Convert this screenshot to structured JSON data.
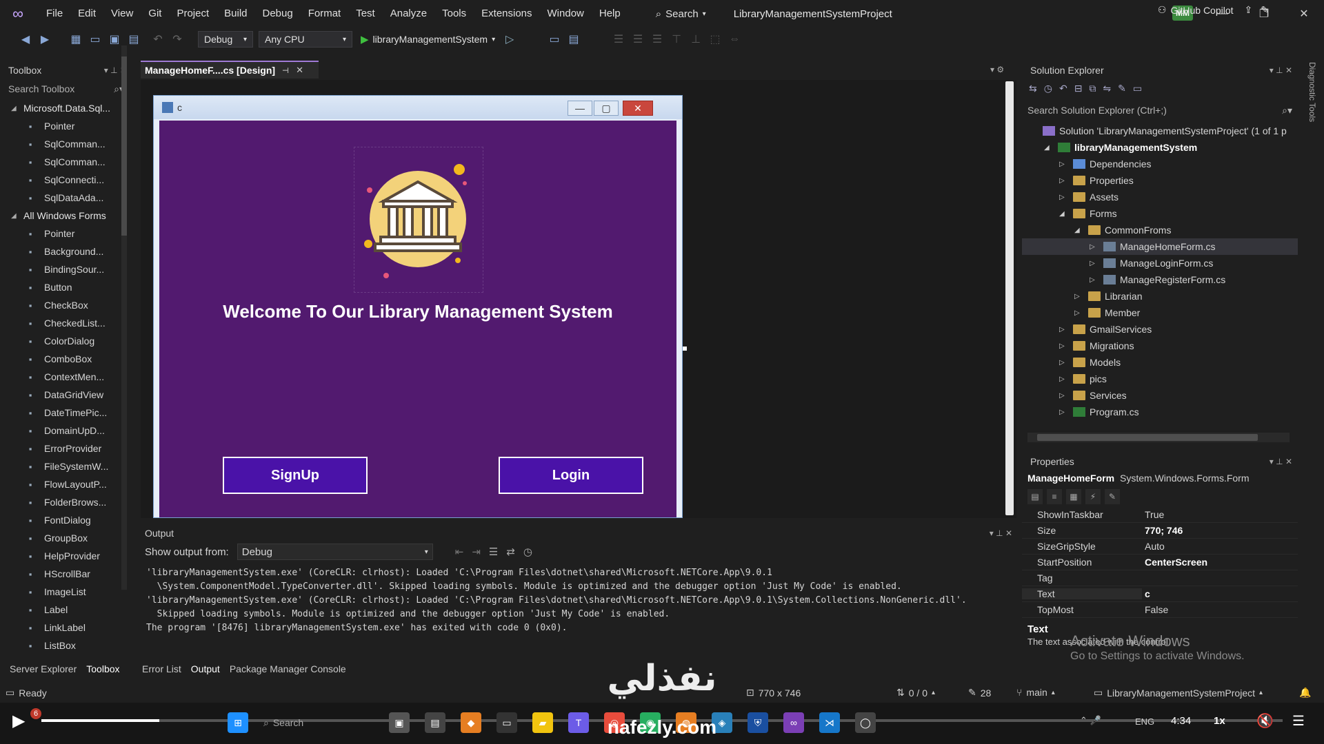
{
  "titlebar": {
    "menus": [
      "File",
      "Edit",
      "View",
      "Git",
      "Project",
      "Build",
      "Debug",
      "Format",
      "Test",
      "Analyze",
      "Tools",
      "Extensions",
      "Window",
      "Help"
    ],
    "search_label": "Search",
    "project_title": "LibraryManagementSystemProject",
    "user_initials": "MM"
  },
  "toolbar": {
    "config": "Debug",
    "platform": "Any CPU",
    "run_target": "libraryManagementSystem",
    "copilot_label": "GitHub Copilot"
  },
  "toolbox": {
    "title": "Toolbox",
    "search_placeholder": "Search Toolbox",
    "category1": "Microsoft.Data.Sql...",
    "category1_items": [
      "Pointer",
      "SqlComman...",
      "SqlComman...",
      "SqlConnecti...",
      "SqlDataAda..."
    ],
    "category2": "All Windows Forms",
    "category2_items": [
      "Pointer",
      "Background...",
      "BindingSour...",
      "Button",
      "CheckBox",
      "CheckedList...",
      "ColorDialog",
      "ComboBox",
      "ContextMen...",
      "DataGridView",
      "DateTimePic...",
      "DomainUpD...",
      "ErrorProvider",
      "FileSystemW...",
      "FlowLayoutP...",
      "FolderBrows...",
      "FontDialog",
      "GroupBox",
      "HelpProvider",
      "HScrollBar",
      "ImageList",
      "Label",
      "LinkLabel",
      "ListBox"
    ],
    "bottom_tabs": [
      "Server Explorer",
      "Toolbox"
    ]
  },
  "designer": {
    "tab_label": "ManageHomeF....cs [Design]",
    "form_title": "c",
    "welcome_text": "Welcome To Our Library Management System",
    "signup_label": "SignUp",
    "login_label": "Login"
  },
  "output": {
    "title": "Output",
    "show_from_label": "Show output from:",
    "source": "Debug",
    "lines": [
      "'libraryManagementSystem.exe' (CoreCLR: clrhost): Loaded 'C:\\Program Files\\dotnet\\shared\\Microsoft.NETCore.App\\9.0.1",
      "  \\System.ComponentModel.TypeConverter.dll'. Skipped loading symbols. Module is optimized and the debugger option 'Just My Code' is enabled.",
      "'libraryManagementSystem.exe' (CoreCLR: clrhost): Loaded 'C:\\Program Files\\dotnet\\shared\\Microsoft.NETCore.App\\9.0.1\\System.Collections.NonGeneric.dll'.",
      "  Skipped loading symbols. Module is optimized and the debugger option 'Just My Code' is enabled.",
      "The program '[8476] libraryManagementSystem.exe' has exited with code 0 (0x0)."
    ],
    "bottom_tabs": [
      "Error List",
      "Output",
      "Package Manager Console"
    ]
  },
  "solution_explorer": {
    "title": "Solution Explorer",
    "search_placeholder": "Search Solution Explorer (Ctrl+;)",
    "items": [
      {
        "label": "Solution 'LibraryManagementSystemProject' (1 of 1 p",
        "depth": 0,
        "icon": "sln",
        "tri": ""
      },
      {
        "label": "libraryManagementSystem",
        "depth": 1,
        "icon": "cs",
        "tri": "◢",
        "bold": true
      },
      {
        "label": "Dependencies",
        "depth": 2,
        "icon": "dep",
        "tri": "▷"
      },
      {
        "label": "Properties",
        "depth": 2,
        "icon": "folder",
        "tri": "▷"
      },
      {
        "label": "Assets",
        "depth": 2,
        "icon": "folder",
        "tri": "▷"
      },
      {
        "label": "Forms",
        "depth": 2,
        "icon": "folder",
        "tri": "◢"
      },
      {
        "label": "CommonFroms",
        "depth": 3,
        "icon": "folder",
        "tri": "◢"
      },
      {
        "label": "ManageHomeForm.cs",
        "depth": 4,
        "icon": "file",
        "tri": "▷",
        "selected": true
      },
      {
        "label": "ManageLoginForm.cs",
        "depth": 4,
        "icon": "file",
        "tri": "▷"
      },
      {
        "label": "ManageRegisterForm.cs",
        "depth": 4,
        "icon": "file",
        "tri": "▷"
      },
      {
        "label": "Librarian",
        "depth": 3,
        "icon": "folder",
        "tri": "▷"
      },
      {
        "label": "Member",
        "depth": 3,
        "icon": "folder",
        "tri": "▷"
      },
      {
        "label": "GmailServices",
        "depth": 2,
        "icon": "folder",
        "tri": "▷"
      },
      {
        "label": "Migrations",
        "depth": 2,
        "icon": "folder",
        "tri": "▷"
      },
      {
        "label": "Models",
        "depth": 2,
        "icon": "folder",
        "tri": "▷"
      },
      {
        "label": "pics",
        "depth": 2,
        "icon": "folder",
        "tri": "▷"
      },
      {
        "label": "Services",
        "depth": 2,
        "icon": "folder",
        "tri": "▷"
      },
      {
        "label": "Program.cs",
        "depth": 2,
        "icon": "cs",
        "tri": "▷"
      }
    ]
  },
  "properties": {
    "title": "Properties",
    "object_name": "ManageHomeForm",
    "object_type": "System.Windows.Forms.Form",
    "rows": [
      {
        "name": "ShowInTaskbar",
        "value": "True",
        "bold": false
      },
      {
        "name": "Size",
        "value": "770; 746",
        "bold": true
      },
      {
        "name": "SizeGripStyle",
        "value": "Auto",
        "bold": false
      },
      {
        "name": "StartPosition",
        "value": "CenterScreen",
        "bold": true
      },
      {
        "name": "Tag",
        "value": "",
        "bold": false
      },
      {
        "name": "Text",
        "value": "c",
        "bold": true
      },
      {
        "name": "TopMost",
        "value": "False",
        "bold": false
      }
    ],
    "desc_title": "Text",
    "desc_text": "The text associated with the control."
  },
  "statusbar": {
    "ready": "Ready",
    "dimensions": "770 x 746",
    "changes": "0 / 0",
    "edits": "28",
    "branch": "main",
    "project": "LibraryManagementSystemProject"
  },
  "overlay": {
    "watermark": "نفذلي",
    "watermark_url": "nafezly.com",
    "activate_title": "Activate Windows",
    "activate_sub": "Go to Settings to activate Windows.",
    "diag_tools": "Diagnostic Tools"
  },
  "taskbar": {
    "search_label": "Search",
    "lang": "ENG",
    "time": "4:34",
    "speed": "1x",
    "progress": 0.095
  },
  "colors": {
    "form_bg": "#521a6f",
    "button_bg": "#4a12a8",
    "accent": "#a07ad6"
  }
}
